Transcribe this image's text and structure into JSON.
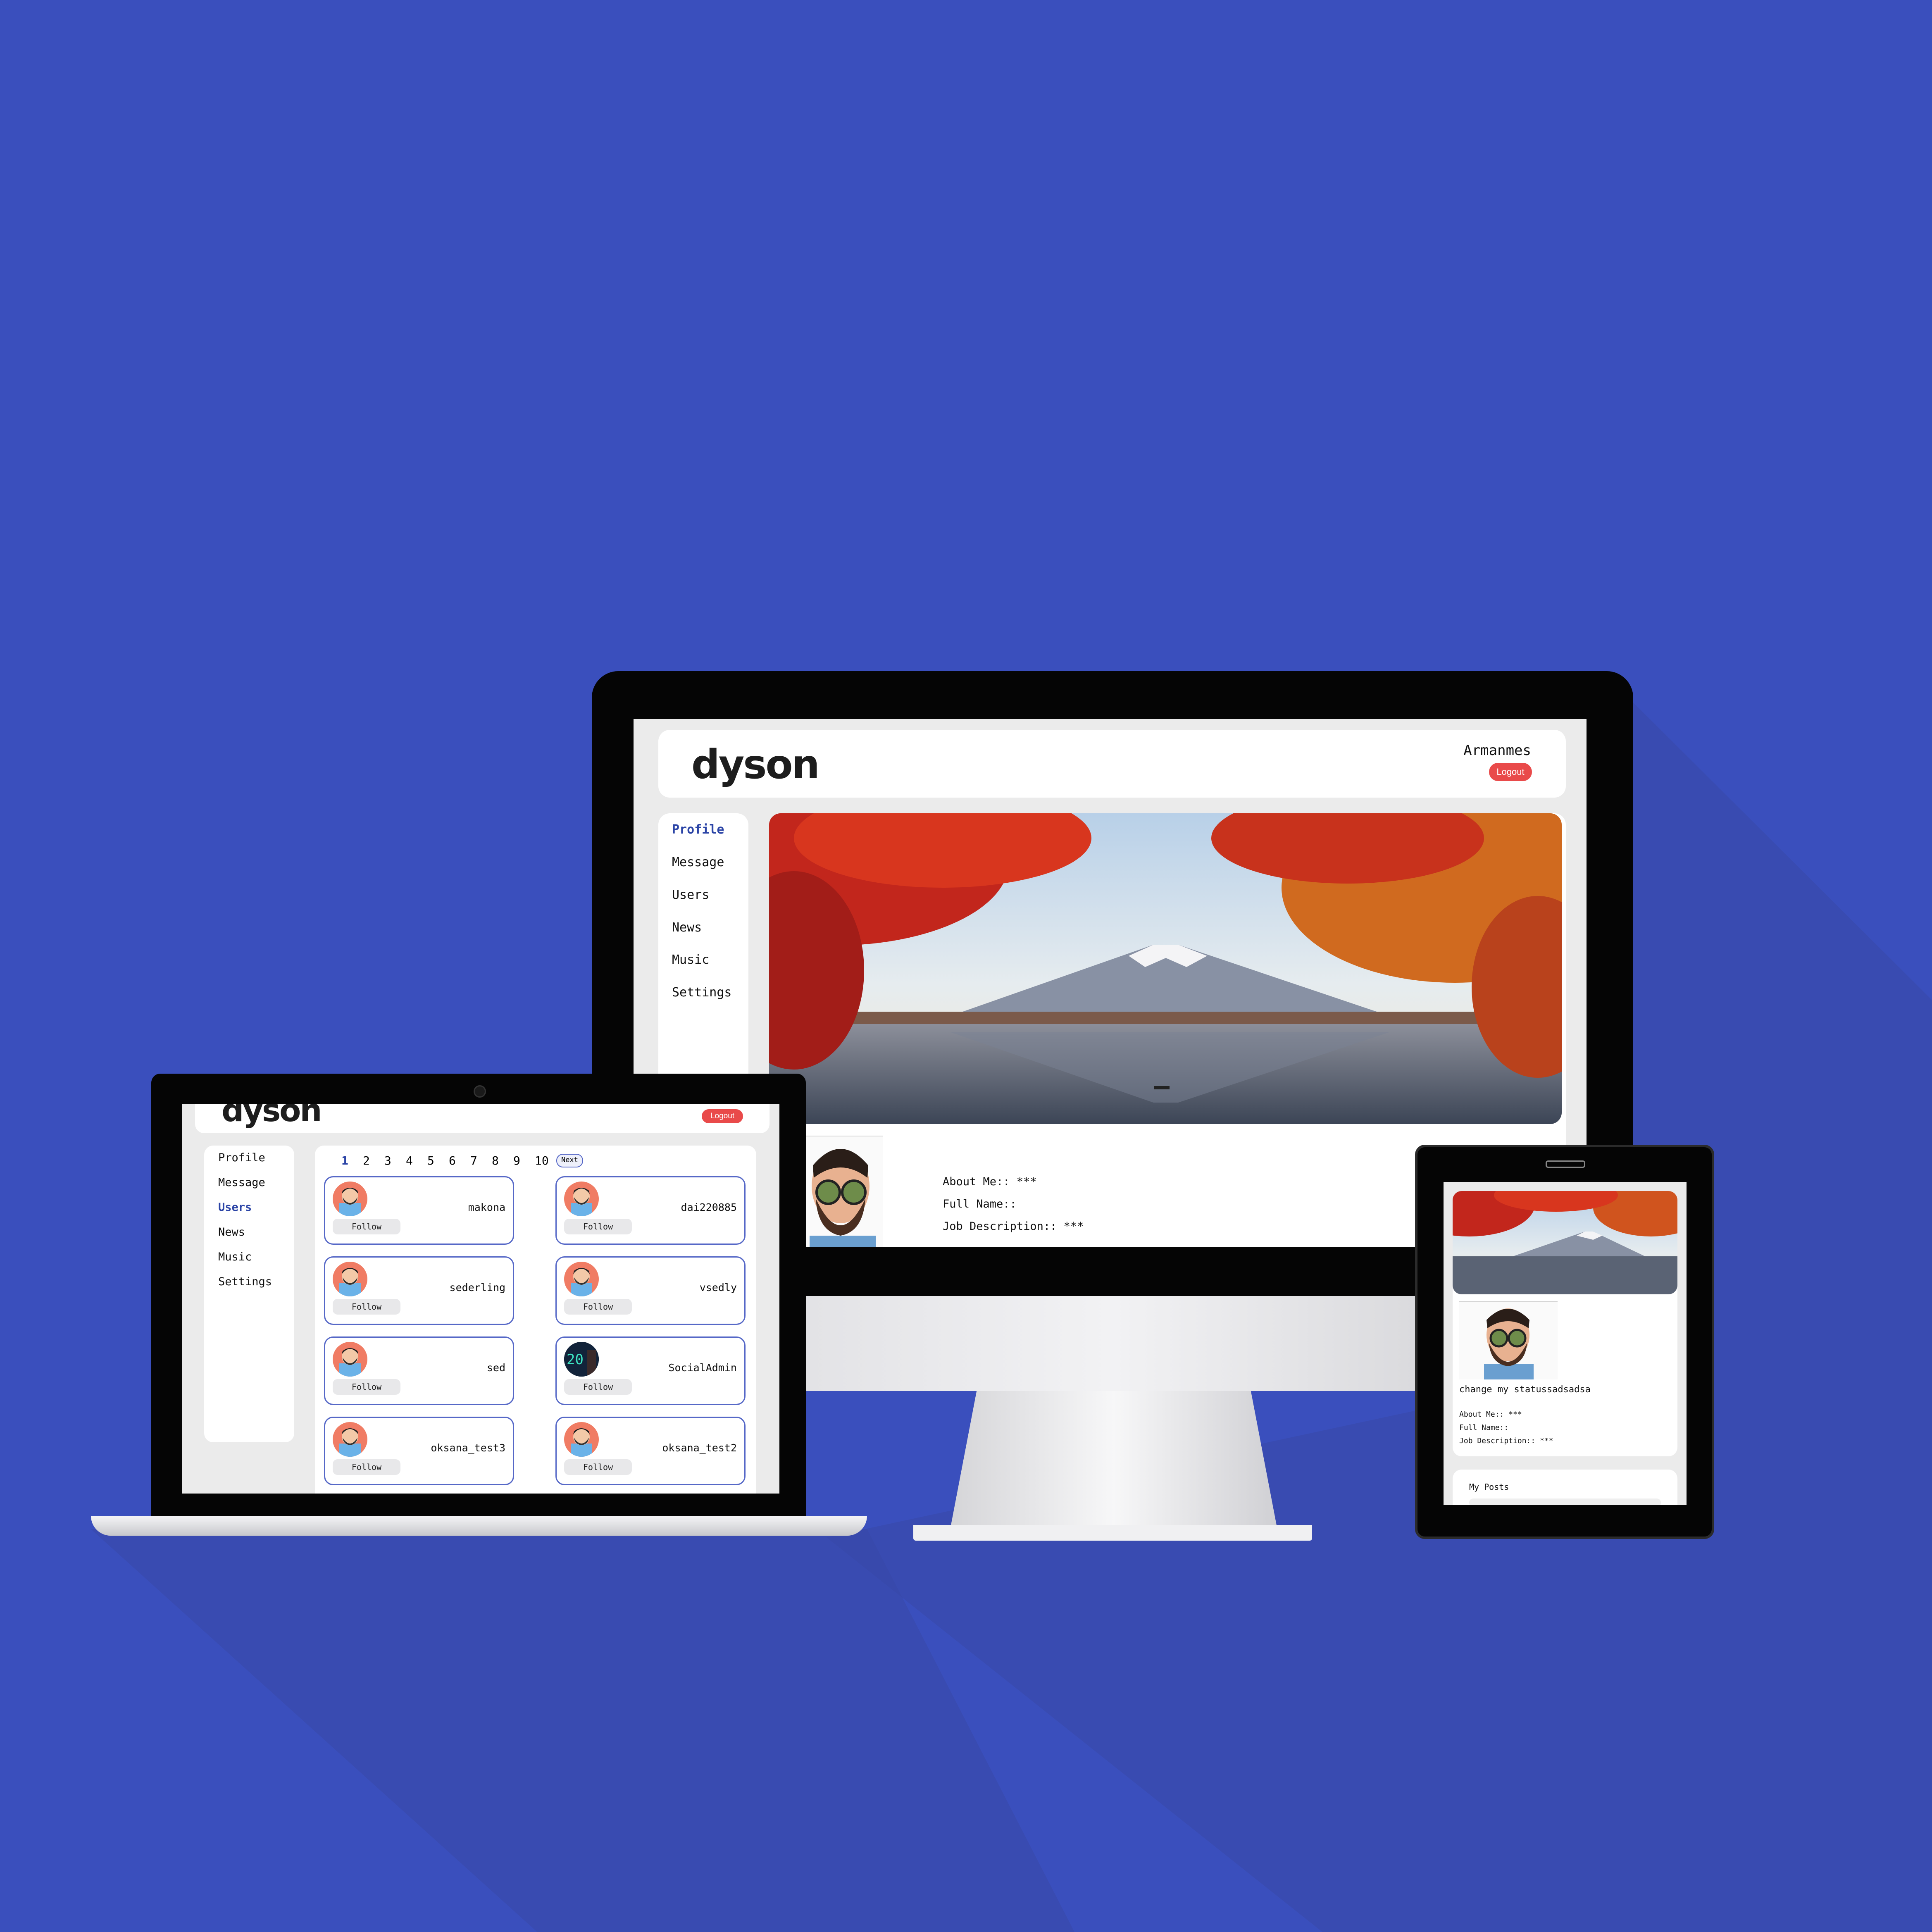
{
  "brand": {
    "logo_text": "dyson",
    "accent": "#e94a4a",
    "active_nav": "#2b44a6",
    "background": "#3a4fbd"
  },
  "desktop": {
    "username": "Armanmes",
    "logout_label": "Logout",
    "nav": [
      "Profile",
      "Message",
      "Users",
      "News",
      "Music",
      "Settings"
    ],
    "active_nav": "Profile",
    "cover_image": "autumn-mount-fuji-lake",
    "avatar_image": "cartoon-man-with-beard-and-sunglasses",
    "about_me": "About Me:: ***",
    "full_name": "Full Name::",
    "job_description": "Job Description:: ***"
  },
  "laptop": {
    "logo_text": "dyson",
    "logout_label": "Logout",
    "nav": [
      "Profile",
      "Message",
      "Users",
      "News",
      "Music",
      "Settings"
    ],
    "active_nav": "Users",
    "pagination": [
      "1",
      "2",
      "3",
      "4",
      "5",
      "6",
      "7",
      "8",
      "9",
      "10"
    ],
    "current_page": "1",
    "next_label": "Next",
    "follow_label": "Follow",
    "users": [
      "makona",
      "dai220885",
      "sederling",
      "vsedly",
      "sed",
      "SocialAdmin",
      "oksana_test3",
      "oksana_test2"
    ]
  },
  "tablet": {
    "status": "change my statussadsadsa",
    "about_me": "About Me:: ***",
    "full_name": "Full Name::",
    "job_description": "Job Description:: ***",
    "my_posts": "My Posts"
  }
}
